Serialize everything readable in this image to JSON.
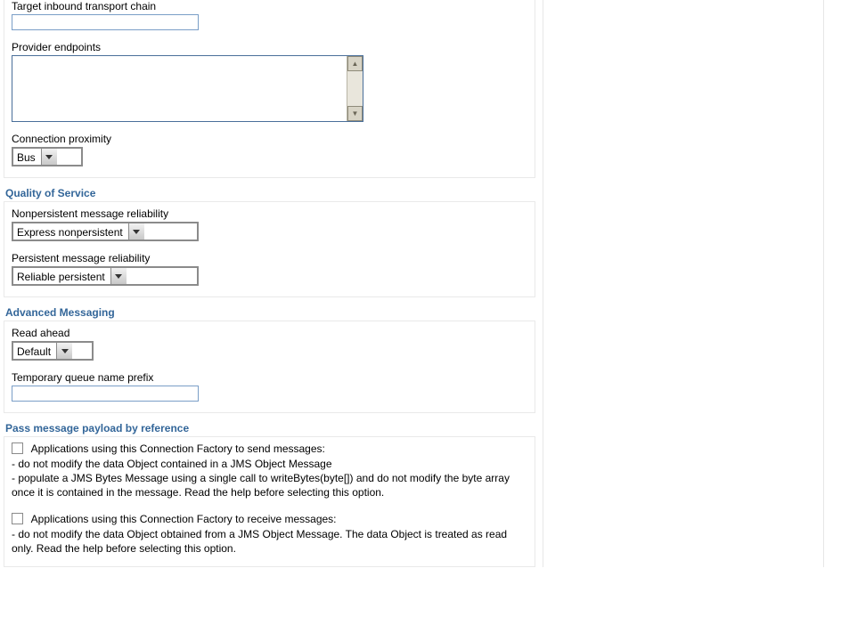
{
  "connection": {
    "target_chain_label": "Target inbound transport chain",
    "target_chain_value": "",
    "provider_endpoints_label": "Provider endpoints",
    "connection_proximity_label": "Connection proximity",
    "connection_proximity_value": "Bus"
  },
  "qos": {
    "title": "Quality of Service",
    "nonpersistent_label": "Nonpersistent message reliability",
    "nonpersistent_value": "Express nonpersistent",
    "persistent_label": "Persistent message reliability",
    "persistent_value": "Reliable persistent"
  },
  "adv": {
    "title": "Advanced Messaging",
    "read_ahead_label": "Read ahead",
    "read_ahead_value": "Default",
    "temp_queue_label": "Temporary queue name prefix",
    "temp_queue_value": ""
  },
  "payload": {
    "title": "Pass message payload by reference",
    "send_label": "Applications using this Connection Factory to send messages:",
    "send_help": "- do not modify the data Object contained in a JMS Object Message\n- populate a JMS Bytes Message using a single call to writeBytes(byte[]) and do not modify the byte array once it is contained in the message. Read the help before selecting this option.",
    "recv_label": "Applications using this Connection Factory to receive messages:",
    "recv_help": "- do not modify the data Object obtained from a JMS Object Message. The data Object is treated as read only. Read the help before selecting this option."
  }
}
